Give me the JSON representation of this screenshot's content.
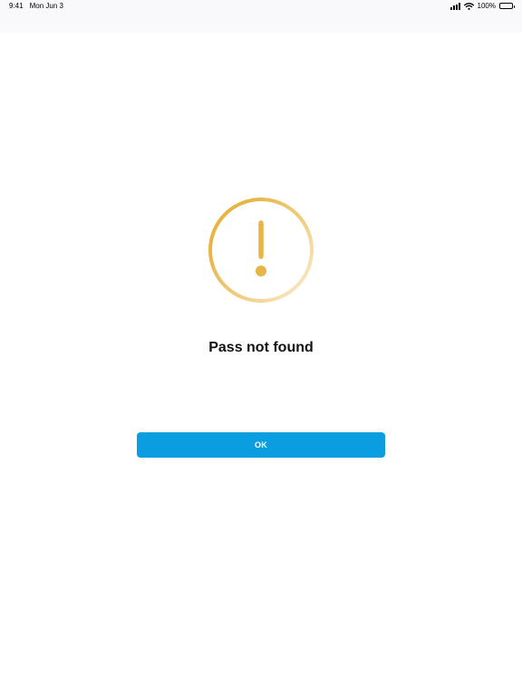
{
  "status_bar": {
    "time": "9:41",
    "date": "Mon Jun 3",
    "battery": "100%",
    "icons": [
      "cellular-signal-icon",
      "wifi-icon",
      "battery-icon"
    ]
  },
  "alert": {
    "icon": "exclamation-circle-icon",
    "title": "Pass not found",
    "ok_label": "OK"
  },
  "colors": {
    "accent": "#0a9ee0",
    "warning": "#e8b64a",
    "status_bar_bg": "#f9f9fb"
  }
}
